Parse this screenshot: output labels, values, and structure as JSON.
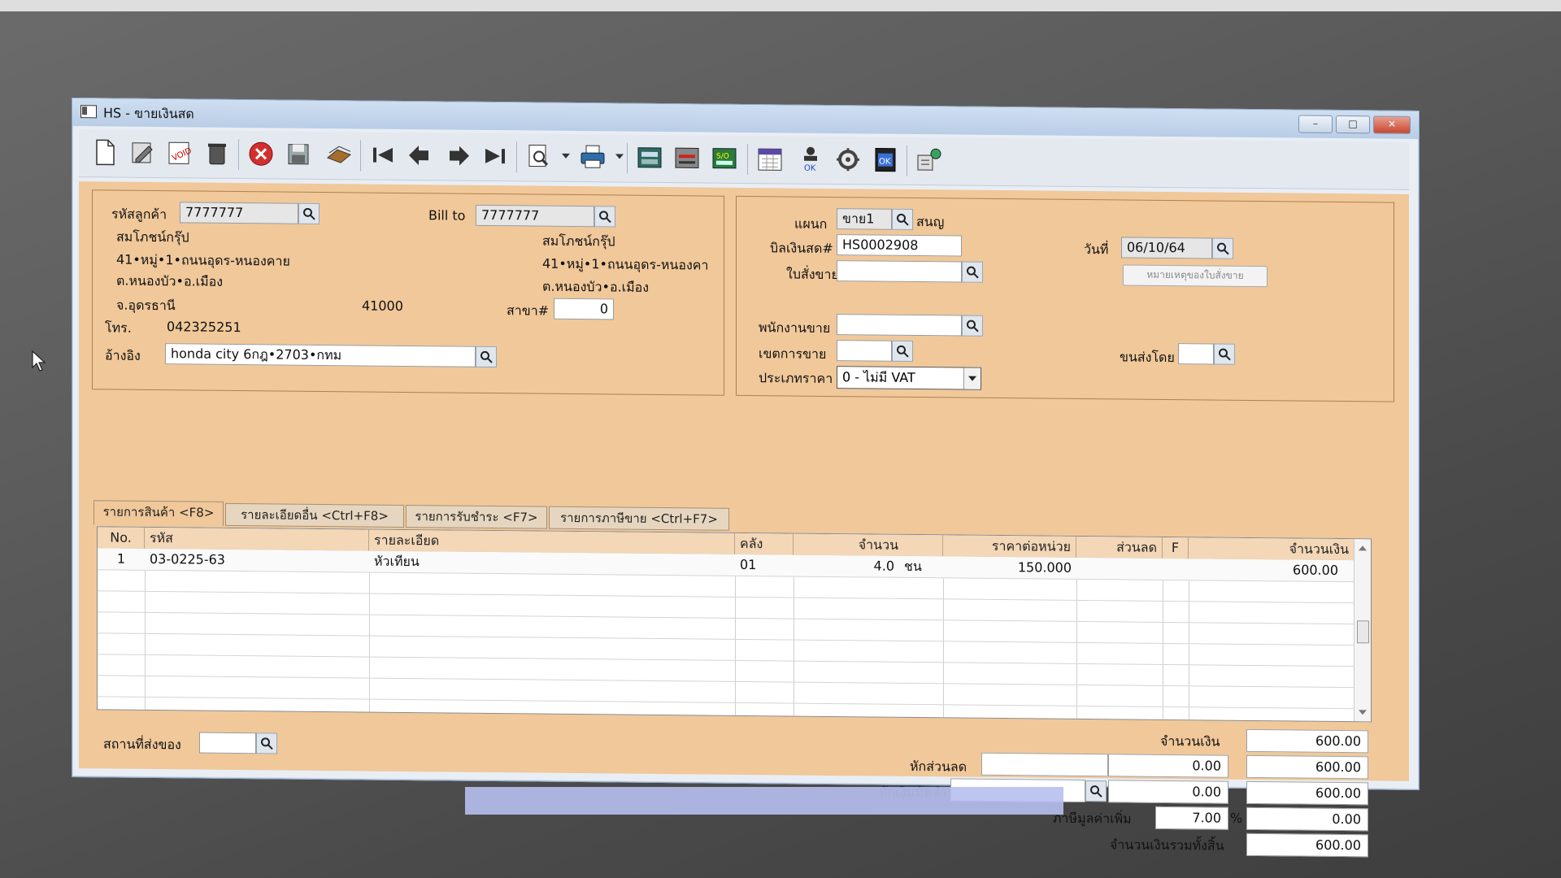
{
  "window": {
    "title": "HS - ขายเงินสด",
    "minimize": "–",
    "maximize": "□",
    "close": "✕"
  },
  "toolbar": {
    "icons": [
      "new-doc-icon",
      "edit-icon",
      "void-icon",
      "trash-icon",
      "cancel-icon",
      "save-icon",
      "copy-icon",
      "first-record-icon",
      "prev-record-icon",
      "next-record-icon",
      "last-record-icon",
      "find-icon",
      "print-icon",
      "report1-icon",
      "report2-icon",
      "sales-order-icon",
      "calendar-icon",
      "approve-icon",
      "tools-icon",
      "ok-icon",
      "connect-icon"
    ]
  },
  "customer": {
    "code_label": "รหัสลูกค้า",
    "code": "7777777",
    "name": "สมโภชน์กรุ๊ป",
    "addr1": "41•หมู่•1•ถนนอุดร-หนองคาย",
    "addr2": "ต.หนองบัว•อ.เมือง",
    "addr3": "จ.อุดรธานี",
    "postcode": "41000",
    "phone_label": "โทร.",
    "phone": "042325251",
    "ref_label": "อ้างอิง",
    "ref": "honda city 6กฎ•2703•กทม"
  },
  "billto": {
    "label": "Bill to",
    "code": "7777777",
    "name": "สมโภชน์กรุ๊ป",
    "addr1": "41•หมู่•1•ถนนอุดร-หนองคา",
    "addr2": "ต.หนองบัว•อ.เมือง",
    "branch_label": "สาขา#",
    "branch": "0"
  },
  "doc": {
    "dept_label": "แผนก",
    "dept": "ขาย1",
    "dept_name": "สนญ",
    "bill_label": "บิลเงินสด#",
    "bill_no": "HS0002908",
    "date_label": "วันที่",
    "date": "06/10/64",
    "so_label": "ใบสั่งขาย",
    "so_note_button": "หมายเหตุของใบสั่งขาย",
    "salesman_label": "พนักงานขาย",
    "area_label": "เขตการขาย",
    "ship_by_label": "ขนส่งโดย",
    "price_type_label": "ประเภทราคา",
    "price_type": "0 - ไม่มี VAT"
  },
  "tabs": [
    "รายการสินค้า <F8>",
    "รายละเอียดอื่น <Ctrl+F8>",
    "รายการรับชำระ <F7>",
    "รายการภาษีขาย <Ctrl+F7>"
  ],
  "grid": {
    "headers": [
      "No.",
      "รหัส",
      "รายละเอียด",
      "คลัง",
      "จำนวน",
      "ราคาต่อหน่วย",
      "ส่วนลด",
      "F",
      "จำนวนเงิน"
    ],
    "rows": [
      {
        "no": "1",
        "code": "03-0225-63",
        "desc": "หัวเทียน",
        "wh": "01",
        "qty": "4.0",
        "unit": "ชน",
        "price": "150.000",
        "disc": "",
        "f": "",
        "amount": "600.00"
      }
    ]
  },
  "footer": {
    "ship_place_label": "สถานที่ส่งของ",
    "amount_label": "จำนวนเงิน",
    "amount": "600.00",
    "discount_label": "หักส่วนลด",
    "discount_val": "0.00",
    "after_discount": "600.00",
    "deposit_label": "หักเงินมัดจำ",
    "deposit_val": "0.00",
    "after_deposit": "600.00",
    "vat_label": "ภาษีมูลค่าเพิ่ม",
    "vat_rate": "7.00",
    "vat_pct": "%",
    "vat_amount": "0.00",
    "total_label": "จำนวนเงินรวมทั้งสิ้น",
    "total": "600.00"
  },
  "colors": {
    "form_bg": "#f0c89a",
    "grid_header": "#f3d7b7",
    "window_bg": "#e9eef5"
  }
}
